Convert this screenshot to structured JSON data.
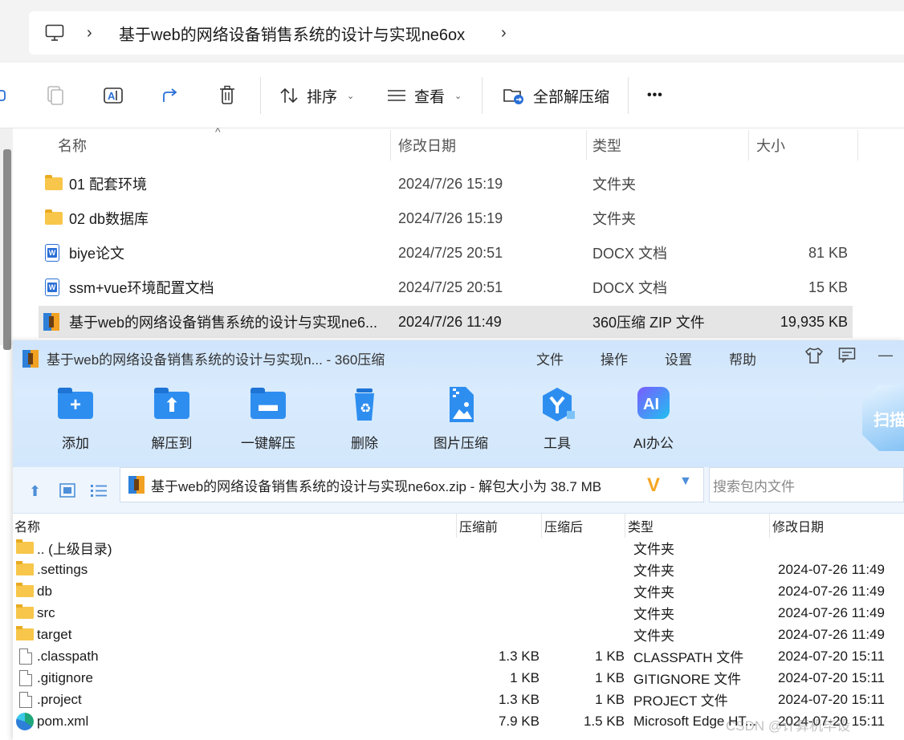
{
  "explorer": {
    "breadcrumb": {
      "current": "基于web的网络设备销售系统的设计与实现ne6ox"
    },
    "toolbar": {
      "sort_label": "排序",
      "view_label": "查看",
      "extract_all_label": "全部解压缩",
      "more_label": "•••"
    },
    "columns": {
      "name": "名称",
      "modified": "修改日期",
      "type": "类型",
      "size": "大小"
    },
    "files": [
      {
        "name": "01 配套环境",
        "modified": "2024/7/26 15:19",
        "type": "文件夹",
        "size": "",
        "icon": "folder-icon"
      },
      {
        "name": "02 db数据库",
        "modified": "2024/7/26 15:19",
        "type": "文件夹",
        "size": "",
        "icon": "folder-icon"
      },
      {
        "name": "biye论文",
        "modified": "2024/7/25 20:51",
        "type": "DOCX 文档",
        "size": "81 KB",
        "icon": "docx-icon"
      },
      {
        "name": "ssm+vue环境配置文档",
        "modified": "2024/7/25 20:51",
        "type": "DOCX 文档",
        "size": "15 KB",
        "icon": "docx-icon"
      },
      {
        "name": "基于web的网络设备销售系统的设计与实现ne6...",
        "modified": "2024/7/26 11:49",
        "type": "360压缩 ZIP 文件",
        "size": "19,935 KB",
        "icon": "zip-icon",
        "selected": true
      }
    ]
  },
  "zipwin": {
    "title": "基于web的网络设备销售系统的设计与实现n... - 360压缩",
    "menu": [
      "文件",
      "操作",
      "设置",
      "帮助"
    ],
    "controls": {
      "minimize": "—"
    },
    "buttons": [
      "添加",
      "解压到",
      "一键解压",
      "删除",
      "图片压缩",
      "工具",
      "AI办公"
    ],
    "scan_badge": "扫描",
    "path": "基于web的网络设备销售系统的设计与实现ne6ox.zip - 解包大小为 38.7 MB",
    "search_placeholder": "搜索包内文件",
    "columns": {
      "name": "名称",
      "before": "压缩前",
      "after": "压缩后",
      "type": "类型",
      "modified": "修改日期"
    },
    "rows": [
      {
        "name": ".. (上级目录)",
        "before": "",
        "after": "",
        "type": "文件夹",
        "modified": "",
        "icon": "folder"
      },
      {
        "name": ".settings",
        "before": "",
        "after": "",
        "type": "文件夹",
        "modified": "2024-07-26 11:49",
        "icon": "folder"
      },
      {
        "name": "db",
        "before": "",
        "after": "",
        "type": "文件夹",
        "modified": "2024-07-26 11:49",
        "icon": "folder"
      },
      {
        "name": "src",
        "before": "",
        "after": "",
        "type": "文件夹",
        "modified": "2024-07-26 11:49",
        "icon": "folder"
      },
      {
        "name": "target",
        "before": "",
        "after": "",
        "type": "文件夹",
        "modified": "2024-07-26 11:49",
        "icon": "folder"
      },
      {
        "name": ".classpath",
        "before": "1.3 KB",
        "after": "1 KB",
        "type": "CLASSPATH 文件",
        "modified": "2024-07-20 15:11",
        "icon": "file"
      },
      {
        "name": ".gitignore",
        "before": "1 KB",
        "after": "1 KB",
        "type": "GITIGNORE 文件",
        "modified": "2024-07-20 15:11",
        "icon": "file"
      },
      {
        "name": ".project",
        "before": "1.3 KB",
        "after": "1 KB",
        "type": "PROJECT 文件",
        "modified": "2024-07-20 15:11",
        "icon": "file"
      },
      {
        "name": "pom.xml",
        "before": "7.9 KB",
        "after": "1.5 KB",
        "type": "Microsoft Edge HT...",
        "modified": "2024-07-20 15:11",
        "icon": "edge"
      }
    ],
    "watermark": "CSDN @计算机毕设"
  }
}
